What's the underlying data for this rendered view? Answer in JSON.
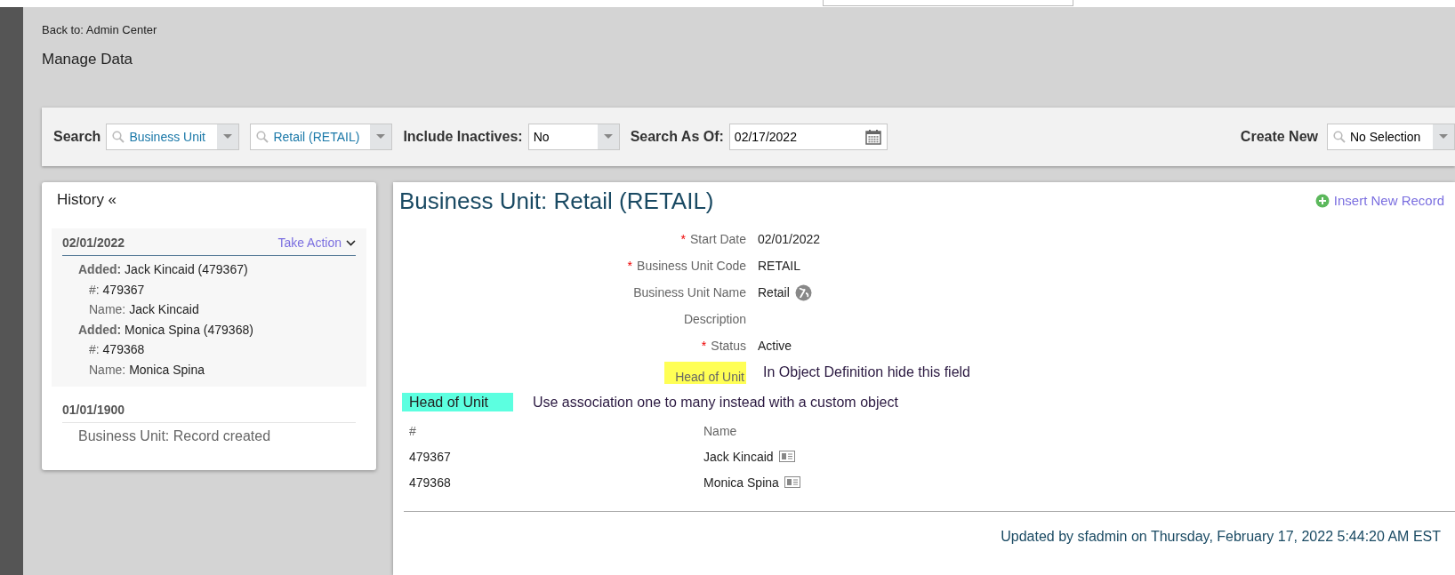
{
  "back_link": "Back to: Admin Center",
  "page_title": "Manage Data",
  "search_bar": {
    "search_label": "Search",
    "object_type": {
      "value": "Business Unit",
      "kind": "lookup"
    },
    "object": {
      "value": "Retail (RETAIL)",
      "kind": "lookup"
    },
    "inactives_label": "Include Inactives:",
    "inactives": {
      "value": "No",
      "kind": "select"
    },
    "as_of_label": "Search As Of:",
    "as_of": {
      "value": "02/17/2022",
      "kind": "date"
    },
    "create_new_label": "Create New",
    "create_new": {
      "value": "No Selection",
      "kind": "lookup"
    }
  },
  "history": {
    "title": "History «",
    "entries": [
      {
        "date": "02/01/2022",
        "selected": true,
        "action": "Take Action",
        "details": [
          {
            "kind": "added",
            "label": "Added:",
            "value": "Jack Kincaid (479367)"
          },
          {
            "kind": "field",
            "label": "#:",
            "value": "479367"
          },
          {
            "kind": "field",
            "label": "Name:",
            "value": "Jack Kincaid"
          },
          {
            "kind": "added",
            "label": "Added:",
            "value": "Monica Spina (479368)"
          },
          {
            "kind": "field",
            "label": "#:",
            "value": "479368"
          },
          {
            "kind": "field",
            "label": "Name:",
            "value": "Monica Spina"
          }
        ]
      },
      {
        "date": "01/01/1900",
        "selected": false,
        "details": [
          {
            "kind": "note",
            "value": "Business Unit: Record created"
          }
        ]
      }
    ]
  },
  "record": {
    "title": "Business Unit: Retail (RETAIL)",
    "insert_link": "Insert New Record",
    "fields": [
      {
        "label": "Start Date",
        "required_mark": "*",
        "value": "02/01/2022"
      },
      {
        "label": "Business Unit Code",
        "required_mark": "*",
        "value": "RETAIL"
      },
      {
        "label": "Business Unit Name",
        "value": "Retail",
        "translatable": true
      },
      {
        "label": "Description"
      },
      {
        "label": "Status",
        "required_mark": "*",
        "value": "Active"
      },
      {
        "label": "Head of Unit",
        "color": "#ffff55",
        "note": "In Object Definition hide this field"
      }
    ],
    "association": {
      "heading": "Head of Unit",
      "color": "#5cffe0",
      "note": "Use association one to many instead with a custom object",
      "columns": [
        "#",
        "Name"
      ],
      "rows": [
        {
          "number": "479367",
          "name": "Jack Kincaid"
        },
        {
          "number": "479368",
          "name": "Monica Spina"
        }
      ]
    },
    "footer": "Updated by sfadmin on Thursday, February 17, 2022 5:44:20 AM EST"
  }
}
